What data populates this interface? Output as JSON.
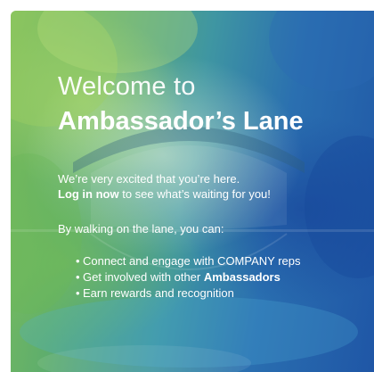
{
  "colors": {
    "text": "#ffffff",
    "overlay_green": "#7fbe5a",
    "overlay_blue": "#1f56a6"
  },
  "welcome": {
    "title_line1": "Welcome to",
    "title_line2": "Ambassador’s Lane",
    "intro_text": "We’re very excited that you’re here.",
    "login_link": "Log in now",
    "login_suffix": " to see what’s waiting for you!",
    "lead": "By walking on the lane, you can:",
    "bullets": [
      {
        "text": "Connect and engage with COMPANY reps"
      },
      {
        "prefix": "Get involved with other ",
        "bold": "Ambassadors"
      },
      {
        "text": "Earn rewards and recognition"
      }
    ]
  }
}
